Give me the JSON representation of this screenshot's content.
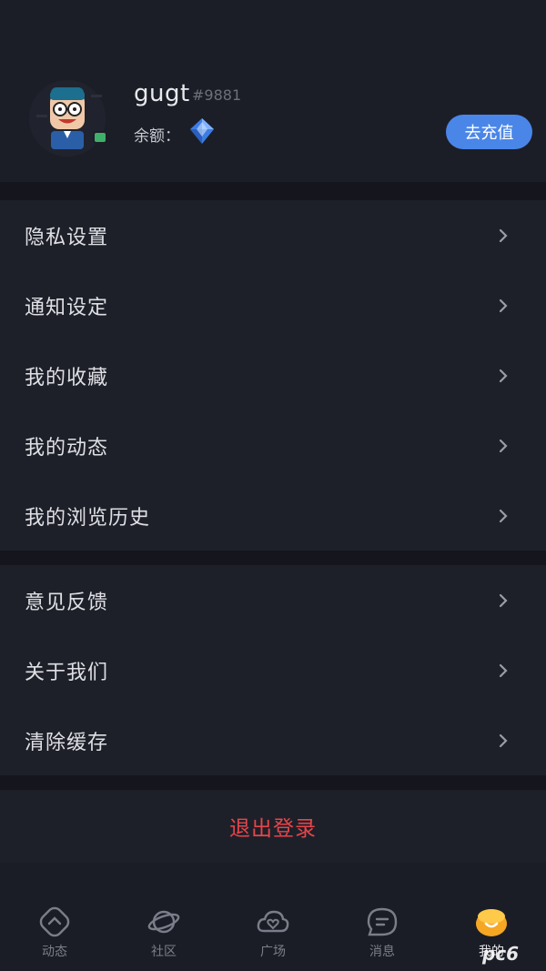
{
  "profile": {
    "username": "gugt",
    "user_tag": "#9881",
    "balance_label": "余额：",
    "recharge_label": "去充值"
  },
  "menu_group_1": [
    {
      "label": "隐私设置"
    },
    {
      "label": "通知设定"
    },
    {
      "label": "我的收藏"
    },
    {
      "label": "我的动态"
    },
    {
      "label": "我的浏览历史"
    }
  ],
  "menu_group_2": [
    {
      "label": "意见反馈"
    },
    {
      "label": "关于我们"
    },
    {
      "label": "清除缓存"
    }
  ],
  "logout_label": "退出登录",
  "tabbar": [
    {
      "label": "动态",
      "icon": "feed-icon"
    },
    {
      "label": "社区",
      "icon": "planet-icon"
    },
    {
      "label": "广场",
      "icon": "cloud-heart-icon"
    },
    {
      "label": "消息",
      "icon": "message-icon"
    },
    {
      "label": "我的",
      "icon": "profile-smile-icon"
    }
  ],
  "watermark": "pc6",
  "colors": {
    "background": "#1b1d26",
    "accent": "#4a86e8",
    "danger": "#e6454a",
    "active_tab": "#f5a623"
  }
}
